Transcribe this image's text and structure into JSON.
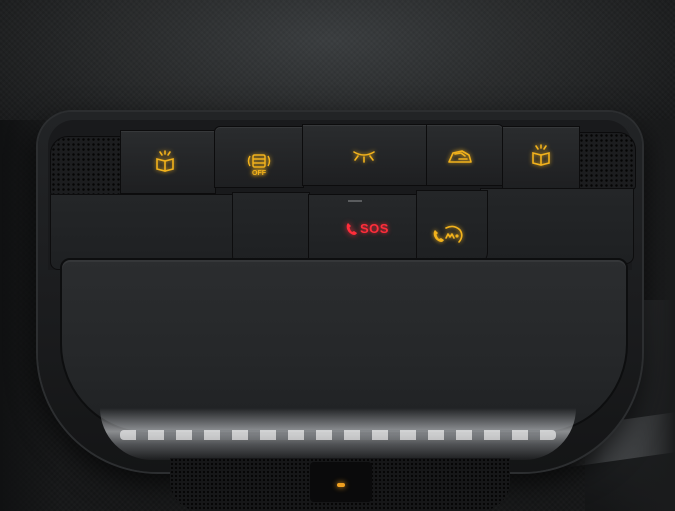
{
  "console": {
    "buttons": [
      {
        "id": "reading-light-left",
        "icon": "reading-light-icon"
      },
      {
        "id": "interior-monitor-off",
        "icon": "car-sensor-icon",
        "label": "OFF"
      },
      {
        "id": "interior-light",
        "icon": "interior-light-icon"
      },
      {
        "id": "sunroof",
        "icon": "sunroof-icon"
      },
      {
        "id": "reading-light-right",
        "icon": "reading-light-icon"
      }
    ],
    "sos_label": "SOS",
    "off_label": "OFF"
  },
  "colors": {
    "indicator_amber": "#f2b21c",
    "sos_red": "#ff2d3a"
  }
}
